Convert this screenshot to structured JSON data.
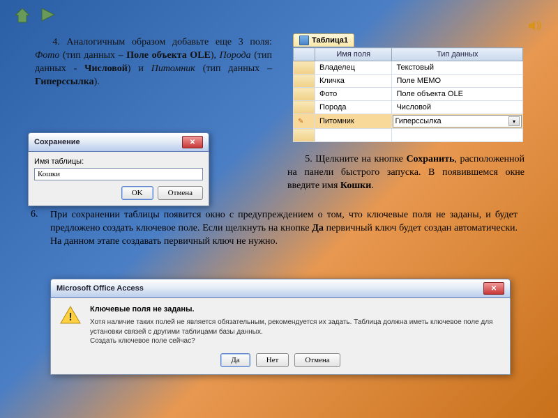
{
  "nav": {
    "home_label": "home",
    "play_label": "play",
    "speaker_label": "speaker"
  },
  "step4": {
    "prefix": "4. Аналогичным образом добавьте еще 3 поля: ",
    "f1": "Фото",
    "f1_suf": " (тип данных – ",
    "f1_type": "Поле объекта OLE",
    "f1_close": "), ",
    "f2": "Порода",
    "f2_suf": " (тип данных - ",
    "f2_type": "Числовой",
    "f2_close": ") и ",
    "f3": "Питомник",
    "f3_suf": " (тип данных – ",
    "f3_type": "Гиперссылка",
    "f3_close": ")."
  },
  "table": {
    "tab": "Таблица1",
    "col1": "Имя поля",
    "col2": "Тип данных",
    "rows": [
      {
        "name": "Владелец",
        "type": "Текстовый"
      },
      {
        "name": "Кличка",
        "type": "Поле МЕМО"
      },
      {
        "name": "Фото",
        "type": "Поле объекта OLE"
      },
      {
        "name": "Порода",
        "type": "Числовой"
      },
      {
        "name": "Питомник",
        "type": "Гиперссылка"
      }
    ]
  },
  "saveDlg": {
    "title": "Сохранение",
    "label": "Имя таблицы:",
    "value": "Кошки",
    "ok": "OK",
    "cancel": "Отмена"
  },
  "step5": {
    "prefix": "5. Щелкните на кнопке ",
    "save": "Сохранить",
    "mid": ", расположенной на панели быстрого запуска. В появившемся окне введите имя ",
    "name": "Кошки",
    "suffix": "."
  },
  "step6": {
    "num": "6.",
    "p1": "При сохранении таблицы появится окно с предупреждением о том, что ключевые поля не заданы, и будет предложено создать ключевое поле. Если щелкнуть на кнопке ",
    "yes": "Да",
    "p2": " первичный ключ будет создан автоматически. На данном этапе создавать первичный ключ не нужно."
  },
  "accessDlg": {
    "app": "Microsoft Office Access",
    "headline": "Ключевые поля не заданы.",
    "t1": "Хотя наличие таких полей не является обязательным, рекомендуется их задать. Таблица должна иметь ключевое поле для установки связей с другими таблицами базы данных.",
    "t2": "Создать ключевое поле сейчас?",
    "yes": "Да",
    "no": "Нет",
    "cancel": "Отмена"
  }
}
